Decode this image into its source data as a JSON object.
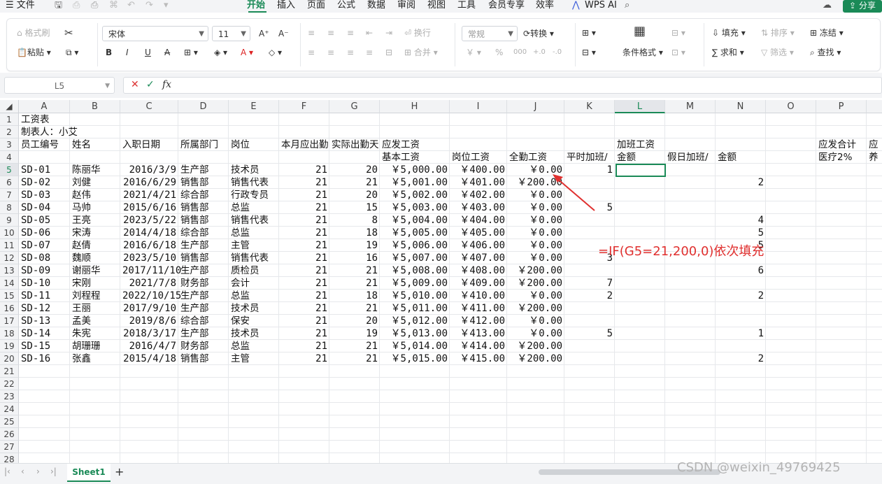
{
  "menu": {
    "file": "文件",
    "tabs": [
      "开始",
      "插入",
      "页面",
      "公式",
      "数据",
      "审阅",
      "视图",
      "工具",
      "会员专享",
      "效率"
    ],
    "active_tab": "开始",
    "ai": "WPS AI",
    "share": "分享"
  },
  "ribbon": {
    "format_painter": "格式刷",
    "paste": "粘贴",
    "font_name": "宋体",
    "font_size": "11",
    "bold": "B",
    "italic": "I",
    "underline": "U",
    "wrap": "换行",
    "merge": "合并",
    "number_format": "常规",
    "convert": "转换",
    "conditional_format": "条件格式",
    "fill": "填充",
    "sort": "排序",
    "freeze": "冻结",
    "sum": "求和",
    "filter": "筛选",
    "find": "查找"
  },
  "formula_bar": {
    "name_box": "L5",
    "formula": ""
  },
  "columns": [
    "A",
    "B",
    "C",
    "D",
    "E",
    "F",
    "G",
    "H",
    "I",
    "J",
    "K",
    "L",
    "M",
    "N",
    "O",
    "P"
  ],
  "selected_column": "L",
  "rows": [
    "1",
    "2",
    "3",
    "4",
    "5",
    "6",
    "7",
    "8",
    "9",
    "10",
    "11",
    "12",
    "13",
    "14",
    "15",
    "16",
    "17",
    "18",
    "19",
    "20",
    "21",
    "22",
    "23",
    "24",
    "25",
    "26",
    "27",
    "28"
  ],
  "selected_row": "5",
  "title_cells": {
    "a1": "工资表",
    "a2": "制表人：小艾",
    "a3": "员工编号",
    "b3": "姓名",
    "c3": "入职日期",
    "d3": "所属部门",
    "e3": "岗位",
    "f3": "本月应出勤",
    "g3": "实际出勤天",
    "h3": "应发工资",
    "l3": "加班工资",
    "p3": "应发合计",
    "q3": "应",
    "h4": "基本工资",
    "i4": "岗位工资",
    "j4": "全勤工资",
    "k4": "平时加班/",
    "l4": "金额",
    "m4": "假日加班/",
    "n4": "金额",
    "p4": "医疗2%",
    "q4": "养"
  },
  "records": [
    {
      "id": "SD-01",
      "name": "陈丽华",
      "date": "2016/3/9",
      "dept": "生产部",
      "pos": "技术员",
      "due": "21",
      "actual": "20",
      "base": "￥5,000.00",
      "post": "￥400.00",
      "full": "￥0.00",
      "k": "1",
      "n": ""
    },
    {
      "id": "SD-02",
      "name": "刘健",
      "date": "2016/6/29",
      "dept": "销售部",
      "pos": "销售代表",
      "due": "21",
      "actual": "21",
      "base": "￥5,001.00",
      "post": "￥401.00",
      "full": "￥200.00",
      "k": "",
      "n": "2"
    },
    {
      "id": "SD-03",
      "name": "赵伟",
      "date": "2021/4/21",
      "dept": "综合部",
      "pos": "行政专员",
      "due": "21",
      "actual": "20",
      "base": "￥5,002.00",
      "post": "￥402.00",
      "full": "￥0.00",
      "k": "",
      "n": ""
    },
    {
      "id": "SD-04",
      "name": "马帅",
      "date": "2015/6/16",
      "dept": "销售部",
      "pos": "总监",
      "due": "21",
      "actual": "15",
      "base": "￥5,003.00",
      "post": "￥403.00",
      "full": "￥0.00",
      "k": "5",
      "n": ""
    },
    {
      "id": "SD-05",
      "name": "王亮",
      "date": "2023/5/22",
      "dept": "销售部",
      "pos": "销售代表",
      "due": "21",
      "actual": "8",
      "base": "￥5,004.00",
      "post": "￥404.00",
      "full": "￥0.00",
      "k": "",
      "n": "4"
    },
    {
      "id": "SD-06",
      "name": "宋涛",
      "date": "2014/4/18",
      "dept": "综合部",
      "pos": "总监",
      "due": "21",
      "actual": "18",
      "base": "￥5,005.00",
      "post": "￥405.00",
      "full": "￥0.00",
      "k": "",
      "n": "5"
    },
    {
      "id": "SD-07",
      "name": "赵倩",
      "date": "2016/6/18",
      "dept": "生产部",
      "pos": "主管",
      "due": "21",
      "actual": "19",
      "base": "￥5,006.00",
      "post": "￥406.00",
      "full": "￥0.00",
      "k": "",
      "n": "5"
    },
    {
      "id": "SD-08",
      "name": "魏顺",
      "date": "2023/5/10",
      "dept": "销售部",
      "pos": "销售代表",
      "due": "21",
      "actual": "16",
      "base": "￥5,007.00",
      "post": "￥407.00",
      "full": "￥0.00",
      "k": "3",
      "n": ""
    },
    {
      "id": "SD-09",
      "name": "谢丽华",
      "date": "2017/11/10",
      "dept": "生产部",
      "pos": "质检员",
      "due": "21",
      "actual": "21",
      "base": "￥5,008.00",
      "post": "￥408.00",
      "full": "￥200.00",
      "k": "",
      "n": "6"
    },
    {
      "id": "SD-10",
      "name": "宋刚",
      "date": "2021/7/8",
      "dept": "财务部",
      "pos": "会计",
      "due": "21",
      "actual": "21",
      "base": "￥5,009.00",
      "post": "￥409.00",
      "full": "￥200.00",
      "k": "7",
      "n": ""
    },
    {
      "id": "SD-11",
      "name": "刘程程",
      "date": "2022/10/15",
      "dept": "生产部",
      "pos": "总监",
      "due": "21",
      "actual": "18",
      "base": "￥5,010.00",
      "post": "￥410.00",
      "full": "￥0.00",
      "k": "2",
      "n": "2"
    },
    {
      "id": "SD-12",
      "name": "王丽",
      "date": "2017/9/10",
      "dept": "生产部",
      "pos": "技术员",
      "due": "21",
      "actual": "21",
      "base": "￥5,011.00",
      "post": "￥411.00",
      "full": "￥200.00",
      "k": "",
      "n": ""
    },
    {
      "id": "SD-13",
      "name": "孟美",
      "date": "2019/8/6",
      "dept": "综合部",
      "pos": "保安",
      "due": "21",
      "actual": "20",
      "base": "￥5,012.00",
      "post": "￥412.00",
      "full": "￥0.00",
      "k": "",
      "n": ""
    },
    {
      "id": "SD-14",
      "name": "朱宪",
      "date": "2018/3/17",
      "dept": "生产部",
      "pos": "技术员",
      "due": "21",
      "actual": "19",
      "base": "￥5,013.00",
      "post": "￥413.00",
      "full": "￥0.00",
      "k": "5",
      "n": "1"
    },
    {
      "id": "SD-15",
      "name": "胡珊珊",
      "date": "2016/4/7",
      "dept": "财务部",
      "pos": "总监",
      "due": "21",
      "actual": "21",
      "base": "￥5,014.00",
      "post": "￥414.00",
      "full": "￥200.00",
      "k": "",
      "n": ""
    },
    {
      "id": "SD-16",
      "name": "张鑫",
      "date": "2015/4/18",
      "dept": "销售部",
      "pos": "主管",
      "due": "21",
      "actual": "21",
      "base": "￥5,015.00",
      "post": "￥415.00",
      "full": "￥200.00",
      "k": "",
      "n": "2"
    }
  ],
  "annotation": "=IF(G5=21,200,0)依次填充",
  "sheet_tab": "Sheet1",
  "watermark": "CSDN @weixin_49769425",
  "colors": {
    "accent": "#1a8a57",
    "annotation": "#e0302f"
  }
}
